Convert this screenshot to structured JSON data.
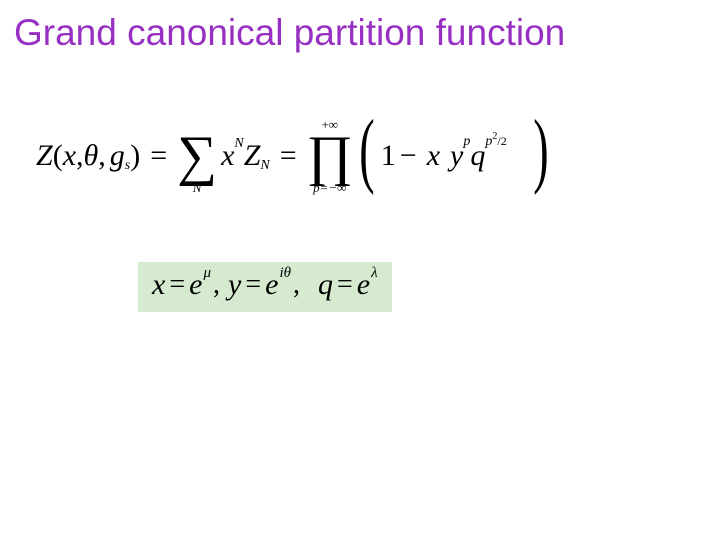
{
  "title": "Grand canonical partition function",
  "eq1": {
    "Z": "Z",
    "lpar": "(",
    "x": "x",
    "comma1": ",",
    "theta": "θ",
    "comma2": ",",
    "g": "g",
    "g_sub": "s",
    "rpar": ")",
    "eq_a": "=",
    "sum_sym": "∑",
    "sum_lower": "N",
    "x2": "x",
    "x2_sup": "N",
    "Z2": "Z",
    "Z2_sub": "N",
    "eq_b": "=",
    "prod_sym": "∏",
    "prod_upper": "+∞",
    "prod_lower": "p=−∞",
    "bigl": "(",
    "one": "1",
    "minus": "−",
    "xin": "x",
    "yin": "y",
    "yin_sup": "p",
    "qin": "q",
    "qin_sup_p": "p",
    "qin_sup_two": "2",
    "qin_sup_slash": "/",
    "qin_sup_den": "2",
    "bigr": ")"
  },
  "eq2": {
    "x": "x",
    "eq1": "=",
    "e1": "e",
    "mu": "μ",
    "c1": ",",
    "y": "y",
    "eq2": "=",
    "e2": "e",
    "itheta": "iθ",
    "c2": ",",
    "q": "q",
    "eq3": "=",
    "e3": "e",
    "lambda": "λ"
  }
}
